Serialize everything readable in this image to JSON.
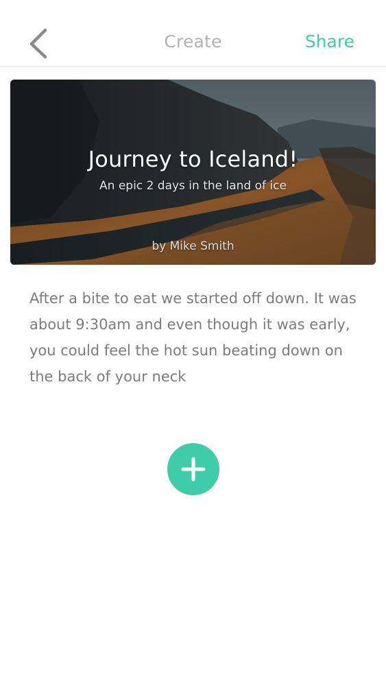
{
  "header": {
    "title": "Create",
    "share_label": "Share",
    "back_icon": "chevron-left-icon"
  },
  "cover": {
    "title": "Journey to Iceland!",
    "subtitle": "An epic 2 days in the land of ice",
    "author": "by Mike Smith"
  },
  "story": {
    "paragraph": "After a bite to eat we started off down. It was about 9:30am and even though it was early, you could feel the hot sun beating down on the back of your neck"
  },
  "actions": {
    "add_icon": "plus-icon"
  },
  "colors": {
    "accent": "#3fcca8",
    "title_gray": "#b2b2b2",
    "body_text": "#7c7c7c"
  }
}
